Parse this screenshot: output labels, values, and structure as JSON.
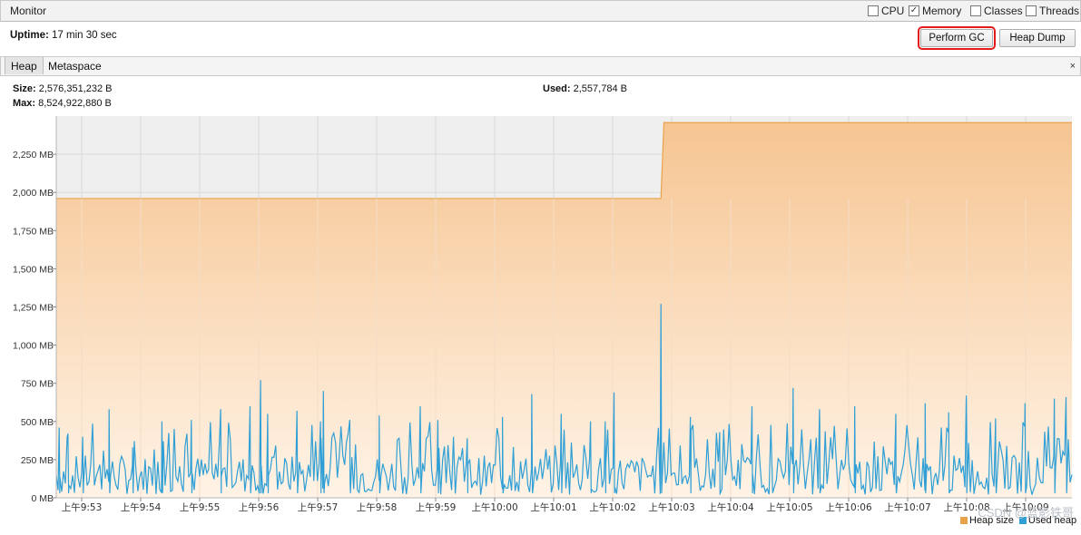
{
  "window": {
    "title": "Monitor"
  },
  "toggles": [
    {
      "label": "CPU",
      "checked": false
    },
    {
      "label": "Memory",
      "checked": true
    },
    {
      "label": "Classes",
      "checked": false
    },
    {
      "label": "Threads",
      "checked": false
    }
  ],
  "uptime": {
    "label": "Uptime:",
    "value": "17 min 30 sec"
  },
  "buttons": {
    "perform_gc": "Perform GC",
    "heap_dump": "Heap Dump"
  },
  "tabs": {
    "heap": "Heap",
    "metaspace": "Metaspace",
    "close_glyph": "×"
  },
  "stats": {
    "size_label": "Size:",
    "size_value": "2,576,351,232 B",
    "max_label": "Max:",
    "max_value": "8,524,922,880 B",
    "used_label": "Used:",
    "used_value": "2,557,784 B"
  },
  "watermark": "CSDN @蓝影铁哥",
  "colors": {
    "accent_border": "#e41b1b",
    "heap_size_fill": "#f6c592",
    "heap_size_line": "#e8a34a",
    "used_heap_line": "#2f9fd6"
  },
  "chart_data": {
    "type": "area",
    "x_tick_labels": [
      "上午9:53",
      "上午9:54",
      "上午9:55",
      "上午9:56",
      "上午9:57",
      "上午9:58",
      "上午9:59",
      "上午10:00",
      "上午10:01",
      "上午10:02",
      "上午10:03",
      "上午10:04",
      "上午10:05",
      "上午10:06",
      "上午10:07",
      "上午10:08",
      "上午10:09"
    ],
    "y_tick_labels": [
      "0 MB",
      "250 MB",
      "500 MB",
      "750 MB",
      "1,000 MB",
      "1,250 MB",
      "1,500 MB",
      "1,750 MB",
      "2,000 MB",
      "2,250 MB"
    ],
    "ylim": [
      0,
      2500
    ],
    "x_range_minutes": [
      0,
      17.3
    ],
    "grid": true,
    "legend": {
      "position": "bottom-right",
      "items": [
        {
          "name": "Heap size"
        },
        {
          "name": "Used heap"
        }
      ]
    },
    "series": [
      {
        "name": "Heap size",
        "unit": "MB",
        "points": [
          {
            "x": 0,
            "y": 1960
          },
          {
            "x": 10.3,
            "y": 1960
          },
          {
            "x": 10.35,
            "y": 2457
          },
          {
            "x": 17.3,
            "y": 2457
          }
        ]
      },
      {
        "name": "Used heap",
        "unit": "MB",
        "spikes": [
          {
            "x": 0.05,
            "y": 460
          },
          {
            "x": 0.2,
            "y": 420
          },
          {
            "x": 0.45,
            "y": 400
          },
          {
            "x": 0.9,
            "y": 580
          },
          {
            "x": 1.3,
            "y": 330
          },
          {
            "x": 1.8,
            "y": 500
          },
          {
            "x": 2.3,
            "y": 510
          },
          {
            "x": 2.8,
            "y": 580
          },
          {
            "x": 3.3,
            "y": 600
          },
          {
            "x": 3.6,
            "y": 550
          },
          {
            "x": 3.3,
            "y": 540
          },
          {
            "x": 3.48,
            "y": 770
          },
          {
            "x": 4.1,
            "y": 570
          },
          {
            "x": 4.5,
            "y": 500
          },
          {
            "x": 4.55,
            "y": 700
          },
          {
            "x": 5.0,
            "y": 510
          },
          {
            "x": 5.5,
            "y": 540
          },
          {
            "x": 6.2,
            "y": 600
          },
          {
            "x": 6.5,
            "y": 510
          },
          {
            "x": 7.0,
            "y": 390
          },
          {
            "x": 7.6,
            "y": 530
          },
          {
            "x": 8.1,
            "y": 680
          },
          {
            "x": 8.6,
            "y": 550
          },
          {
            "x": 9.1,
            "y": 500
          },
          {
            "x": 9.35,
            "y": 500
          },
          {
            "x": 9.5,
            "y": 690
          },
          {
            "x": 10.3,
            "y": 1270
          },
          {
            "x": 10.8,
            "y": 530
          },
          {
            "x": 11.3,
            "y": 430
          },
          {
            "x": 11.85,
            "y": 600
          },
          {
            "x": 12.55,
            "y": 720
          },
          {
            "x": 13.0,
            "y": 580
          },
          {
            "x": 13.6,
            "y": 600
          },
          {
            "x": 14.3,
            "y": 550
          },
          {
            "x": 14.8,
            "y": 620
          },
          {
            "x": 15.2,
            "y": 560
          },
          {
            "x": 15.5,
            "y": 670
          },
          {
            "x": 16.0,
            "y": 520
          },
          {
            "x": 16.5,
            "y": 620
          },
          {
            "x": 17.0,
            "y": 650
          },
          {
            "x": 17.2,
            "y": 660
          }
        ],
        "baseline_band_mb": [
          0,
          300
        ]
      }
    ]
  }
}
